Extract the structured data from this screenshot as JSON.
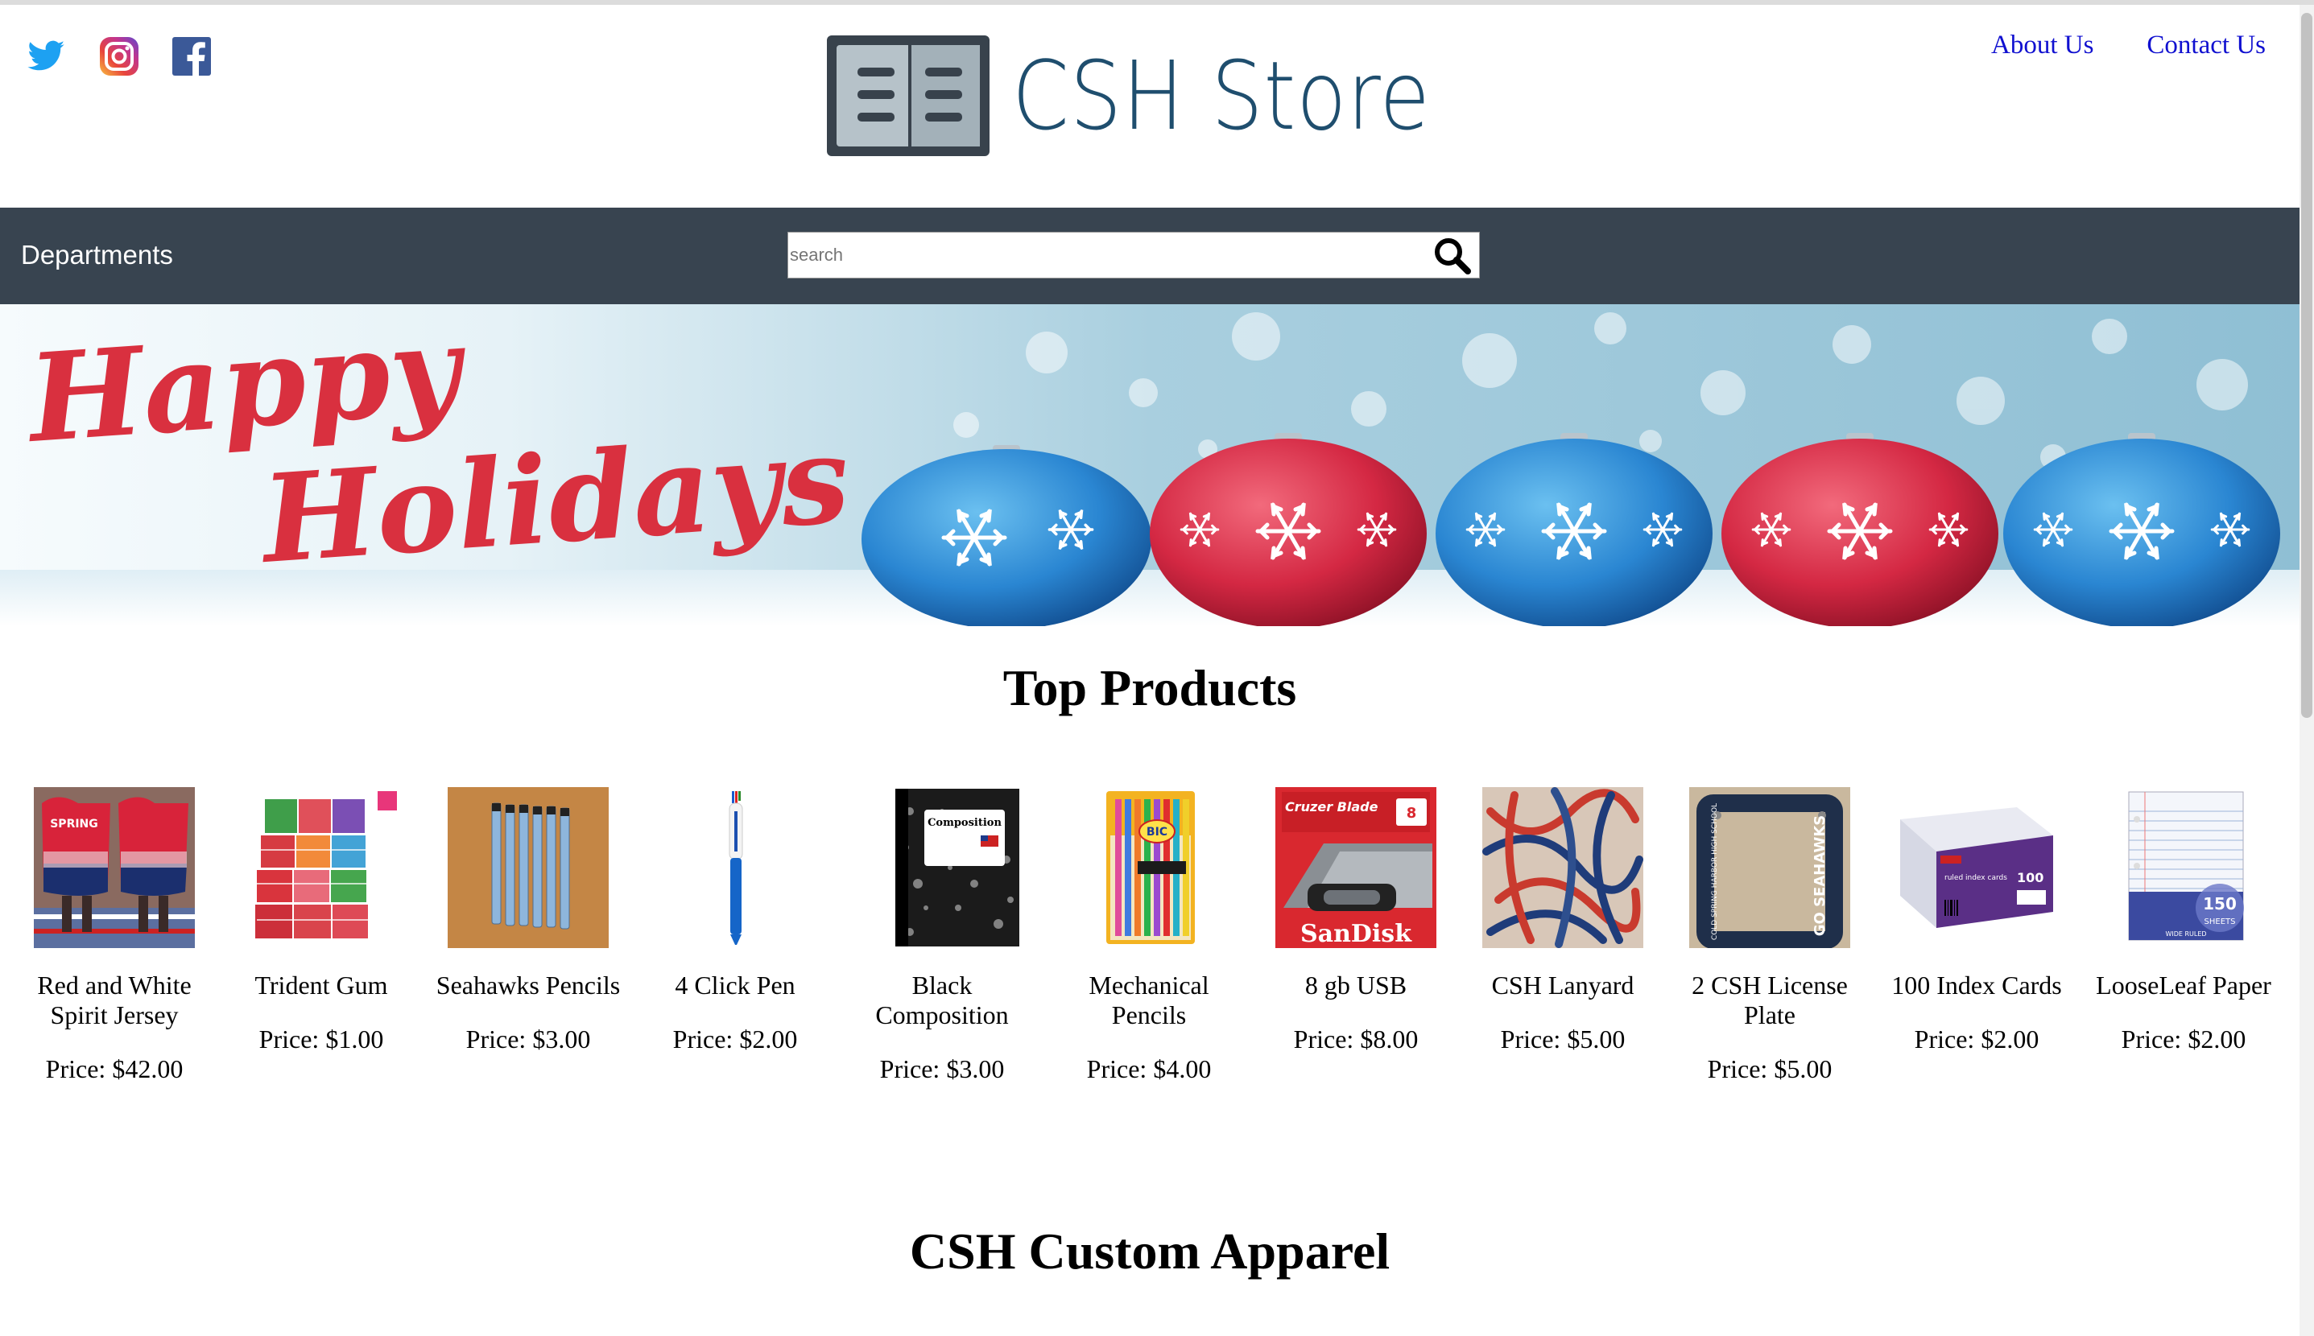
{
  "header": {
    "store_name": "CSH Store",
    "social_icons": [
      "twitter-icon",
      "instagram-icon",
      "facebook-icon"
    ],
    "links": [
      {
        "label": "About Us"
      },
      {
        "label": "Contact Us"
      }
    ]
  },
  "navbar": {
    "departments_label": "Departments",
    "search_placeholder": "search",
    "search_icon": "magnifier-icon"
  },
  "banner": {
    "text_line1": "Happy",
    "text_line2": "Holidays"
  },
  "top_products": {
    "title": "Top Products",
    "items": [
      {
        "name": "Red and White Spirit Jersey",
        "price": "Price: $42.00"
      },
      {
        "name": "Trident Gum",
        "price": "Price: $1.00"
      },
      {
        "name": "Seahawks Pencils",
        "price": "Price: $3.00"
      },
      {
        "name": "4 Click Pen",
        "price": "Price: $2.00"
      },
      {
        "name": "Black Composition",
        "price": "Price: $3.00"
      },
      {
        "name": "Mechanical Pencils",
        "price": "Price: $4.00"
      },
      {
        "name": "8 gb USB",
        "price": "Price: $8.00"
      },
      {
        "name": "CSH Lanyard",
        "price": "Price: $5.00"
      },
      {
        "name": "2 CSH License Plate",
        "price": "Price: $5.00"
      },
      {
        "name": "100 Index Cards",
        "price": "Price: $2.00"
      },
      {
        "name": "LooseLeaf Paper",
        "price": "Price: $2.00"
      }
    ]
  },
  "apparel": {
    "title": "CSH Custom Apparel"
  },
  "colors": {
    "navbar": "#384450",
    "link": "#1010d0",
    "logo_text": "#1f4e6e"
  }
}
